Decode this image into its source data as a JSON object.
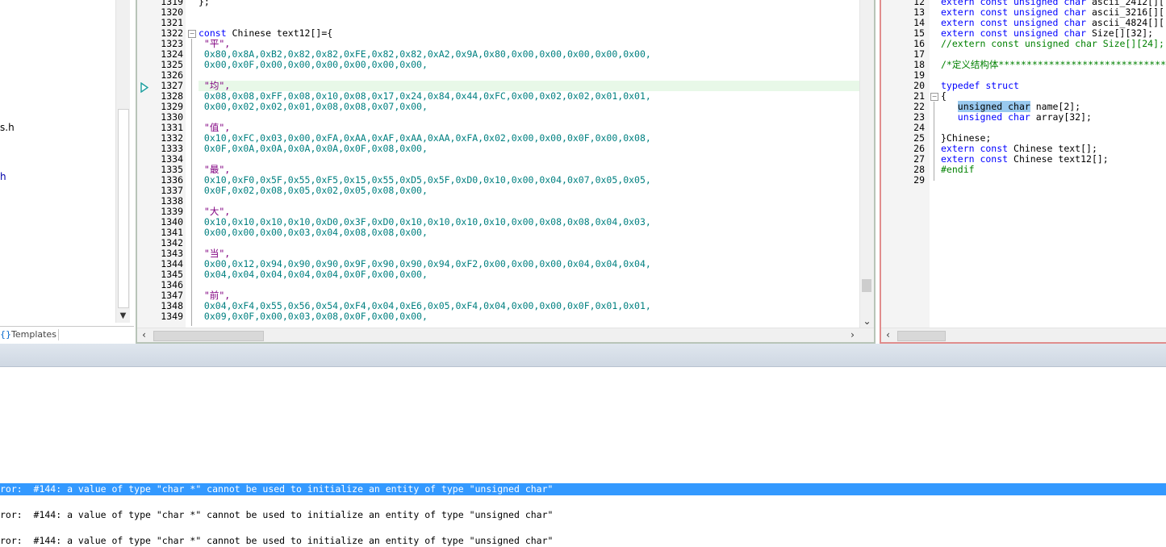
{
  "left_pane": {
    "tree_fragments": [
      "s.h",
      "h"
    ],
    "tabs": [
      "Templates"
    ],
    "tab_icon": "templates-icon"
  },
  "editor_main": {
    "first_line": 1319,
    "current_line": 1327,
    "lines": [
      {
        "n": 1319,
        "t": [
          [
            "plain",
            "};"
          ]
        ]
      },
      {
        "n": 1320,
        "t": []
      },
      {
        "n": 1321,
        "t": []
      },
      {
        "n": 1322,
        "t": [
          [
            "kw",
            "const"
          ],
          [
            "plain",
            " Chinese text12[]={"
          ]
        ],
        "fold": "open"
      },
      {
        "n": 1323,
        "t": [
          [
            "str",
            " \"平\","
          ]
        ]
      },
      {
        "n": 1324,
        "t": [
          [
            "num",
            " 0x80,0x8A,0xB2,0x82,0x82,0xFE,0x82,0x82,0xA2,0x9A,0x80,0x00,0x00,0x00,0x00,0x00,"
          ]
        ]
      },
      {
        "n": 1325,
        "t": [
          [
            "num",
            " 0x00,0x0F,0x00,0x00,0x00,0x00,0x00,0x00,"
          ]
        ]
      },
      {
        "n": 1326,
        "t": []
      },
      {
        "n": 1327,
        "t": [
          [
            "str",
            " \"均\","
          ]
        ]
      },
      {
        "n": 1328,
        "t": [
          [
            "num",
            " 0x08,0x08,0xFF,0x08,0x10,0x08,0x17,0x24,0x84,0x44,0xFC,0x00,0x02,0x02,0x01,0x01,"
          ]
        ]
      },
      {
        "n": 1329,
        "t": [
          [
            "num",
            " 0x00,0x02,0x02,0x01,0x08,0x08,0x07,0x00,"
          ]
        ]
      },
      {
        "n": 1330,
        "t": []
      },
      {
        "n": 1331,
        "t": [
          [
            "str",
            " \"值\","
          ]
        ]
      },
      {
        "n": 1332,
        "t": [
          [
            "num",
            " 0x10,0xFC,0x03,0x00,0xFA,0xAA,0xAF,0xAA,0xAA,0xFA,0x02,0x00,0x00,0x0F,0x00,0x08,"
          ]
        ]
      },
      {
        "n": 1333,
        "t": [
          [
            "num",
            " 0x0F,0x0A,0x0A,0x0A,0x0A,0x0F,0x08,0x00,"
          ]
        ]
      },
      {
        "n": 1334,
        "t": []
      },
      {
        "n": 1335,
        "t": [
          [
            "str",
            " \"最\","
          ]
        ]
      },
      {
        "n": 1336,
        "t": [
          [
            "num",
            " 0x10,0xF0,0x5F,0x55,0xF5,0x15,0x55,0xD5,0x5F,0xD0,0x10,0x00,0x04,0x07,0x05,0x05,"
          ]
        ]
      },
      {
        "n": 1337,
        "t": [
          [
            "num",
            " 0x0F,0x02,0x08,0x05,0x02,0x05,0x08,0x00,"
          ]
        ]
      },
      {
        "n": 1338,
        "t": []
      },
      {
        "n": 1339,
        "t": [
          [
            "str",
            " \"大\","
          ]
        ]
      },
      {
        "n": 1340,
        "t": [
          [
            "num",
            " 0x10,0x10,0x10,0x10,0xD0,0x3F,0xD0,0x10,0x10,0x10,0x10,0x00,0x08,0x08,0x04,0x03,"
          ]
        ]
      },
      {
        "n": 1341,
        "t": [
          [
            "num",
            " 0x00,0x00,0x00,0x03,0x04,0x08,0x08,0x00,"
          ]
        ]
      },
      {
        "n": 1342,
        "t": []
      },
      {
        "n": 1343,
        "t": [
          [
            "str",
            " \"当\","
          ]
        ]
      },
      {
        "n": 1344,
        "t": [
          [
            "num",
            " 0x00,0x12,0x94,0x90,0x90,0x9F,0x90,0x90,0x94,0xF2,0x00,0x00,0x00,0x04,0x04,0x04,"
          ]
        ]
      },
      {
        "n": 1345,
        "t": [
          [
            "num",
            " 0x04,0x04,0x04,0x04,0x04,0x0F,0x00,0x00,"
          ]
        ]
      },
      {
        "n": 1346,
        "t": []
      },
      {
        "n": 1347,
        "t": [
          [
            "str",
            " \"前\","
          ]
        ]
      },
      {
        "n": 1348,
        "t": [
          [
            "num",
            " 0x04,0xF4,0x55,0x56,0x54,0xF4,0x04,0xE6,0x05,0xF4,0x04,0x00,0x00,0x0F,0x01,0x01,"
          ]
        ]
      },
      {
        "n": 1349,
        "t": [
          [
            "num",
            " 0x09,0x0F,0x00,0x03,0x08,0x0F,0x00,0x00,"
          ]
        ]
      }
    ]
  },
  "editor_right": {
    "lines": [
      {
        "n": 12,
        "t": [
          [
            "kw",
            "extern const unsigned char"
          ],
          [
            "plain",
            " ascii_2412[]["
          ]
        ]
      },
      {
        "n": 13,
        "t": [
          [
            "kw",
            "extern const unsigned char"
          ],
          [
            "plain",
            " ascii_3216[]["
          ]
        ]
      },
      {
        "n": 14,
        "t": [
          [
            "kw",
            "extern const unsigned char"
          ],
          [
            "plain",
            " ascii_4824[]["
          ]
        ]
      },
      {
        "n": 15,
        "t": [
          [
            "kw",
            "extern const unsigned char"
          ],
          [
            "plain",
            " Size[][32];"
          ]
        ]
      },
      {
        "n": 16,
        "t": [
          [
            "cmt",
            "//extern const unsigned char Size[][24];"
          ]
        ]
      },
      {
        "n": 17,
        "t": []
      },
      {
        "n": 18,
        "t": [
          [
            "cmt",
            "/*定义结构体*********************************"
          ]
        ]
      },
      {
        "n": 19,
        "t": []
      },
      {
        "n": 20,
        "t": [
          [
            "kw",
            "typedef struct"
          ]
        ]
      },
      {
        "n": 21,
        "t": [
          [
            "plain",
            "{"
          ]
        ],
        "fold": "open"
      },
      {
        "n": 22,
        "t": [
          [
            "plain",
            "   "
          ],
          [
            "sel",
            "unsigned char"
          ],
          [
            "plain",
            " name[2];"
          ]
        ]
      },
      {
        "n": 23,
        "t": [
          [
            "plain",
            "   "
          ],
          [
            "kw",
            "unsigned char"
          ],
          [
            "plain",
            " array[32];"
          ]
        ]
      },
      {
        "n": 24,
        "t": []
      },
      {
        "n": 25,
        "t": [
          [
            "plain",
            "}Chinese;"
          ]
        ]
      },
      {
        "n": 26,
        "t": [
          [
            "kw",
            "extern const"
          ],
          [
            "plain",
            " Chinese text[];"
          ]
        ]
      },
      {
        "n": 27,
        "t": [
          [
            "kw",
            "extern const"
          ],
          [
            "plain",
            " Chinese text12[];"
          ]
        ]
      },
      {
        "n": 28,
        "t": [
          [
            "pre",
            "#endif"
          ]
        ]
      },
      {
        "n": 29,
        "t": []
      }
    ]
  },
  "output": {
    "lines": [
      {
        "text": "ror:  #144: a value of type \"char *\" cannot be used to initialize an entity of type \"unsigned char\"",
        "active": true
      },
      {
        "text": "ror:  #144: a value of type \"char *\" cannot be used to initialize an entity of type \"unsigned char\"",
        "active": false
      },
      {
        "text": "ror:  #144: a value of type \"char *\" cannot be used to initialize an entity of type \"unsigned char\"",
        "active": false
      }
    ]
  },
  "icons": {
    "scroll_left": "‹",
    "scroll_right": "›",
    "scroll_down": "⌄",
    "scroll_up": "▲"
  },
  "colors": {
    "keyword": "#0000ff",
    "number": "#008080",
    "string": "#800080",
    "comment": "#008000",
    "selection": "#99c9ef",
    "active_output": "#3399ff"
  }
}
